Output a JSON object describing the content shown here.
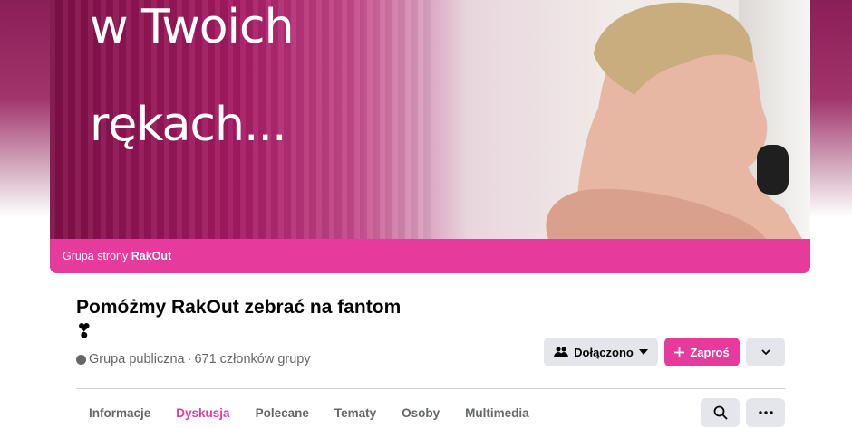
{
  "cover": {
    "headline_line1": "w Twoich",
    "headline_line2": "rękach...",
    "bar_prefix": "Grupa strony",
    "bar_page": "RakOut"
  },
  "group": {
    "title": "Pomóżmy RakOut zebrać na fantom ❣",
    "privacy": "Grupa publiczna",
    "separator": "·",
    "members": "671 członków grupy"
  },
  "actions": {
    "joined_label": "Dołączono",
    "invite_label": "Zaproś"
  },
  "tabs": [
    {
      "label": "Informacje"
    },
    {
      "label": "Dyskusja"
    },
    {
      "label": "Polecane"
    },
    {
      "label": "Tematy"
    },
    {
      "label": "Osoby"
    },
    {
      "label": "Multimedia"
    }
  ],
  "colors": {
    "accent": "#e63a9c",
    "button_grey": "#e4e6eb",
    "text_secondary": "#65676b"
  }
}
